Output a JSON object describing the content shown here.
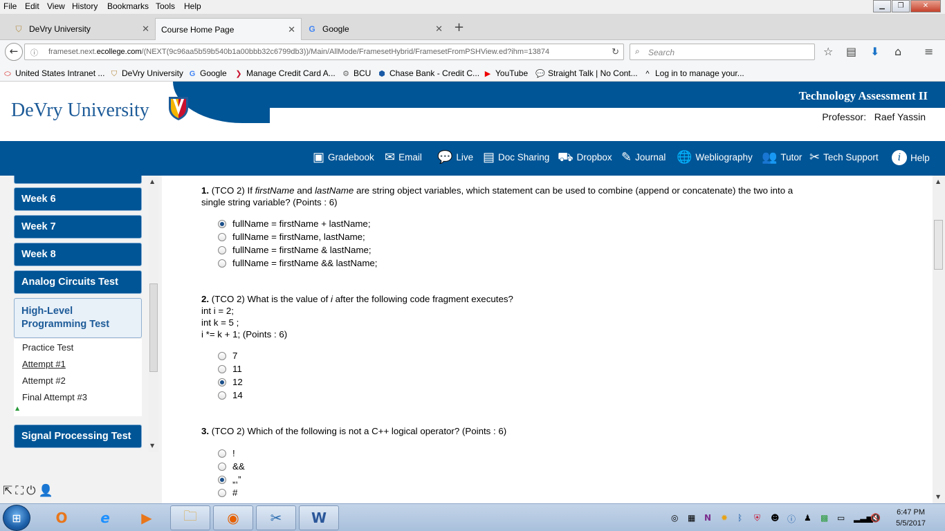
{
  "menubar": {
    "items": [
      "File",
      "Edit",
      "View",
      "History",
      "Bookmarks",
      "Tools",
      "Help"
    ]
  },
  "tabs": [
    {
      "label": "DeVry University",
      "active": false
    },
    {
      "label": "Course Home Page",
      "active": true
    },
    {
      "label": "Google",
      "active": false
    }
  ],
  "navbar": {
    "url_prefix": "frameset.next.",
    "url_domain": "ecollege.com",
    "url_path": "/(NEXT(9c96aa5b59b540b1a00bbb32c6799db3))/Main/AllMode/FramesetHybrid/FramesetFromPSHView.ed?ihm=13874",
    "search_placeholder": "Search"
  },
  "bookmarks": [
    {
      "label": "United States Intranet ...",
      "icon": "red-oval-icon"
    },
    {
      "label": "DeVry University",
      "icon": "devry-shield-icon"
    },
    {
      "label": "Google",
      "icon": "google-g-icon"
    },
    {
      "label": "Manage Credit Card A...",
      "icon": "swoosh-icon"
    },
    {
      "label": "BCU",
      "icon": "gear-globe-icon"
    },
    {
      "label": "Chase Bank - Credit C...",
      "icon": "chase-icon"
    },
    {
      "label": "YouTube",
      "icon": "youtube-icon"
    },
    {
      "label": "Straight Talk | No Cont...",
      "icon": "speech-bubble-icon"
    },
    {
      "label": "Log in to manage your...",
      "icon": "caret-icon"
    }
  ],
  "header": {
    "logo_text": "DeVry University",
    "course_title": "Technology Assessment II",
    "professor_label": "Professor:",
    "professor_name": "Raef Yassin"
  },
  "toolbar": [
    {
      "label": "Gradebook",
      "icon": "gradebook-icon"
    },
    {
      "label": "Email",
      "icon": "envelope-icon"
    },
    {
      "label": "Live",
      "icon": "chat-bubbles-icon"
    },
    {
      "label": "Doc Sharing",
      "icon": "document-icon"
    },
    {
      "label": "Dropbox",
      "icon": "dropbox-icon"
    },
    {
      "label": "Journal",
      "icon": "pencil-box-icon"
    },
    {
      "label": "Webliography",
      "icon": "globe-icon"
    },
    {
      "label": "Tutor",
      "icon": "people-icon"
    },
    {
      "label": "Tech Support",
      "icon": "tools-icon"
    },
    {
      "label": "Help",
      "icon": "info-icon"
    }
  ],
  "leftnav": {
    "weeks": [
      "Week 6",
      "Week 7",
      "Week 8"
    ],
    "analog": "Analog Circuits Test",
    "open_line1": "High-Level",
    "open_line2": "Programming Test",
    "sub": [
      "Practice Test",
      "Attempt #1",
      "Attempt #2",
      "Final Attempt #3"
    ],
    "signal": "Signal Processing Test"
  },
  "questions": [
    {
      "num": "1.",
      "tco": "(TCO 2) If",
      "v1": "firstName",
      "and": "and",
      "v2": "lastName",
      "rest": "are string object variables, which statement can be used to combine (append or concatenate) the two into a",
      "line2": "single string variable? (Points : 6)",
      "options": [
        "fullName = firstName + lastName;",
        "fullName = firstName, lastName;",
        "fullName = firstName & lastName;",
        "fullName = firstName && lastName;"
      ],
      "selected": 0
    },
    {
      "num": "2.",
      "tco": "(TCO 2) What is the value of",
      "var": "i",
      "rest": "after the following code fragment executes?",
      "code1": "int i = 2;",
      "code2": "int k = 5 ;",
      "code3": "i *= k + 1; (Points : 6)",
      "options": [
        "7",
        "11",
        "12",
        "14"
      ],
      "selected": 2
    },
    {
      "num": "3.",
      "text": "(TCO 2) Which of the following is not a C++ logical operator? (Points : 6)",
      "options": [
        "!",
        "&&",
        "„,”",
        "#"
      ],
      "selected": 2
    }
  ],
  "taskbar": {
    "time": "6:47 PM",
    "date": "5/5/2017"
  }
}
